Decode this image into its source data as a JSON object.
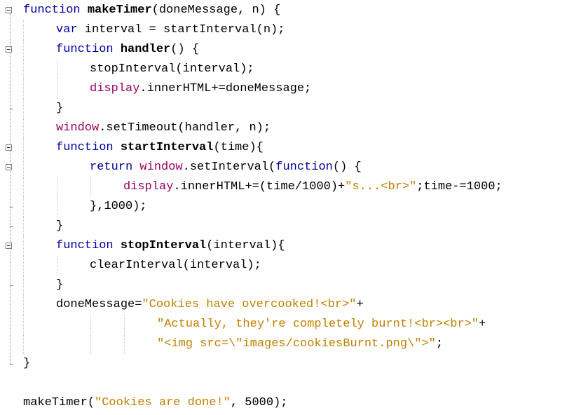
{
  "code": {
    "lines": [
      [
        {
          "t": "function",
          "c": "kw"
        },
        {
          "t": " "
        },
        {
          "t": "makeTimer",
          "c": "b"
        },
        {
          "t": "(doneMessage, n) {"
        }
      ],
      [
        {
          "t": "var",
          "c": "kw"
        },
        {
          "t": " interval = startInterval(n);"
        }
      ],
      [
        {
          "t": "function",
          "c": "kw"
        },
        {
          "t": " "
        },
        {
          "t": "handler",
          "c": "b"
        },
        {
          "t": "() {"
        }
      ],
      [
        {
          "t": "stopInterval(interval);"
        }
      ],
      [
        {
          "t": "display",
          "c": "bi"
        },
        {
          "t": ".innerHTML+=doneMessage;"
        }
      ],
      [
        {
          "t": "}"
        }
      ],
      [
        {
          "t": "window",
          "c": "bi"
        },
        {
          "t": ".setTimeout(handler, n);"
        }
      ],
      [
        {
          "t": "function",
          "c": "kw"
        },
        {
          "t": " "
        },
        {
          "t": "startInterval",
          "c": "b"
        },
        {
          "t": "(time){"
        }
      ],
      [
        {
          "t": "return",
          "c": "kw"
        },
        {
          "t": " "
        },
        {
          "t": "window",
          "c": "bi"
        },
        {
          "t": ".setInterval("
        },
        {
          "t": "function",
          "c": "kw"
        },
        {
          "t": "() {"
        }
      ],
      [
        {
          "t": "display",
          "c": "bi"
        },
        {
          "t": ".innerHTML+=(time/1000)+"
        },
        {
          "t": "\"s...<br>\"",
          "c": "str"
        },
        {
          "t": ";time-=1000;"
        }
      ],
      [
        {
          "t": "},1000);"
        }
      ],
      [
        {
          "t": "}"
        }
      ],
      [
        {
          "t": "function",
          "c": "kw"
        },
        {
          "t": " "
        },
        {
          "t": "stopInterval",
          "c": "b"
        },
        {
          "t": "(interval){"
        }
      ],
      [
        {
          "t": "clearInterval(interval);"
        }
      ],
      [
        {
          "t": "}"
        }
      ],
      [
        {
          "t": "doneMessage="
        },
        {
          "t": "\"Cookies have overcooked!<br>\"",
          "c": "str"
        },
        {
          "t": "+"
        }
      ],
      [
        {
          "t": "\"Actually, they're completely burnt!<br><br>\"",
          "c": "str"
        },
        {
          "t": "+"
        }
      ],
      [
        {
          "t": "\"<img src=\\\"images/cookiesBurnt.png\\\">\"",
          "c": "str"
        },
        {
          "t": ";"
        }
      ],
      [
        {
          "t": "}"
        }
      ],
      [],
      [
        {
          "t": "makeTimer("
        },
        {
          "t": "\"Cookies are done!\"",
          "c": "str"
        },
        {
          "t": ", 5000);"
        }
      ]
    ]
  },
  "colors": {
    "keyword": "#00009c",
    "string": "#c08000",
    "builtin": "#98005e",
    "text": "#000000"
  }
}
